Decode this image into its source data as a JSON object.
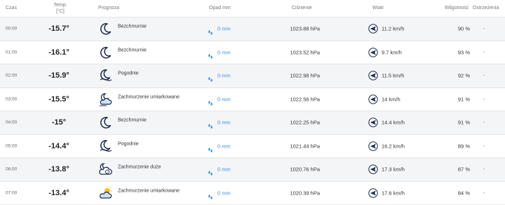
{
  "headers": {
    "time": "Czas",
    "temp_line1": "Temp.",
    "temp_line2": "[°C]",
    "forecast": "Prognoza",
    "precip": "Opad mm",
    "pressure": "Ciśnienie",
    "wind": "Wiatr",
    "humidity": "Wilgotność",
    "warnings": "Ostrzeżenia"
  },
  "rows": [
    {
      "time": "00:00",
      "temp": "-15.7°",
      "icon": "moon-icon",
      "desc": "Bezchmurnie",
      "precip": "0 mm",
      "pressure": "1023.88 hPa",
      "wind": "11.2 km/h",
      "humidity": "90 %",
      "warning": "-"
    },
    {
      "time": "01:00",
      "temp": "-16.1°",
      "icon": "moon-icon",
      "desc": "Bezchmurnie",
      "precip": "0 mm",
      "pressure": "1023.52 hPa",
      "wind": "9.7 km/h",
      "humidity": "93 %",
      "warning": "-"
    },
    {
      "time": "02:00",
      "temp": "-15.9°",
      "icon": "moon-fog-icon",
      "desc": "Pogodnie",
      "precip": "0 mm",
      "pressure": "1022.98 hPa",
      "wind": "11.5 km/h",
      "humidity": "92 %",
      "warning": "-"
    },
    {
      "time": "03:00",
      "temp": "-15.5°",
      "icon": "partly-cloudy-night-icon",
      "desc": "Zachmurzenie umiarkowane",
      "precip": "0 mm",
      "pressure": "1022.56 hPa",
      "wind": "14 km/h",
      "humidity": "91 %",
      "warning": "-"
    },
    {
      "time": "04:00",
      "temp": "-15°",
      "icon": "moon-icon",
      "desc": "Bezchmurnie",
      "precip": "0 mm",
      "pressure": "1022.25 hPa",
      "wind": "14.4 km/h",
      "humidity": "91 %",
      "warning": "-"
    },
    {
      "time": "05:00",
      "temp": "-14.4°",
      "icon": "moon-fog-icon",
      "desc": "Pogodnie",
      "precip": "0 mm",
      "pressure": "1021.44 hPa",
      "wind": "16.2 km/h",
      "humidity": "89 %",
      "warning": "-"
    },
    {
      "time": "06:00",
      "temp": "-13.8°",
      "icon": "cloudy-night-icon",
      "desc": "Zachmurzenie duże",
      "precip": "0 mm",
      "pressure": "1020.76 hPa",
      "wind": "17.3 km/h",
      "humidity": "87 %",
      "warning": "-"
    },
    {
      "time": "07:00",
      "temp": "-13.4°",
      "icon": "partly-cloudy-day-icon",
      "desc": "Zachmurzenie umiarkowane",
      "precip": "0 mm",
      "pressure": "1020.39 hPa",
      "wind": "17.6 km/h",
      "humidity": "84 %",
      "warning": "-"
    }
  ],
  "colors": {
    "accent": "#3d8de5",
    "icon_navy": "#1c2b4a",
    "sun": "#f4c020"
  }
}
